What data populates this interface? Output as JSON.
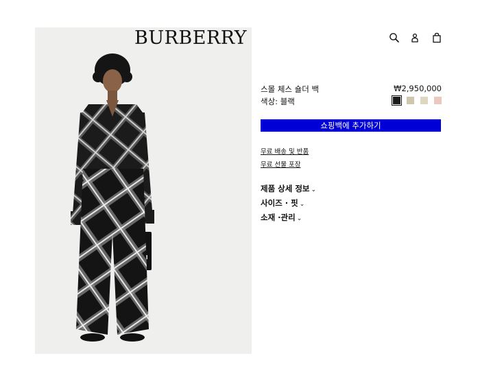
{
  "brand": {
    "logo_text": "BURBERRY"
  },
  "header": {
    "icons": [
      "search-icon",
      "account-icon",
      "shopping-bag-icon"
    ]
  },
  "product": {
    "name": "스몰 체스 숄더 백",
    "price": "₩2,950,000",
    "color_label": "색상: 블랙",
    "swatches": [
      {
        "name": "black",
        "color": "#1a1a1a",
        "selected": true
      },
      {
        "name": "beige-1",
        "color": "#cdc8ad",
        "selected": false
      },
      {
        "name": "beige-2",
        "color": "#ddd7c2",
        "selected": false
      },
      {
        "name": "pink",
        "color": "#ecc9bf",
        "selected": false
      }
    ],
    "add_to_bag_label": "쇼핑백에 추가하기",
    "add_to_bag_color": "#0000d6",
    "links": {
      "shipping_returns": "무료 배송 및 반품",
      "gift_wrap": "무료 선물 포장"
    },
    "sections": {
      "details": "제품 상세 정보",
      "size_fit": "사이즈 · 핏",
      "material_care": "소재 ·관리"
    },
    "chevron": "⌄"
  }
}
